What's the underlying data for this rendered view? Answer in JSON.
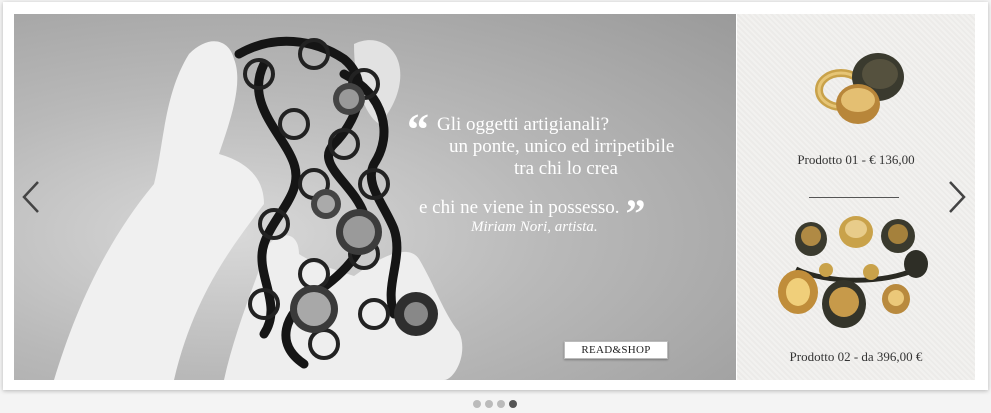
{
  "slide": {
    "quote_lines": [
      "Gli oggetti artigianali?",
      "un ponte, unico ed irripetibile",
      "tra chi lo crea",
      "e chi ne viene in possesso."
    ],
    "quote_open_glyph": "“",
    "quote_close_glyph": "”",
    "author": "Miriam Nori, artista.",
    "cta_label": "READ&SHOP"
  },
  "products": [
    {
      "caption": "Prodotto 01 - € 136,00"
    },
    {
      "caption": "Prodotto 02 - da 396,00 €"
    }
  ],
  "nav": {
    "prev_icon": "chevron-left-icon",
    "next_icon": "chevron-right-icon"
  },
  "pager": {
    "count": 4,
    "active_index": 3
  },
  "colors": {
    "accent_gold": "#c9a24a",
    "dark_metal": "#3a3a2e"
  }
}
